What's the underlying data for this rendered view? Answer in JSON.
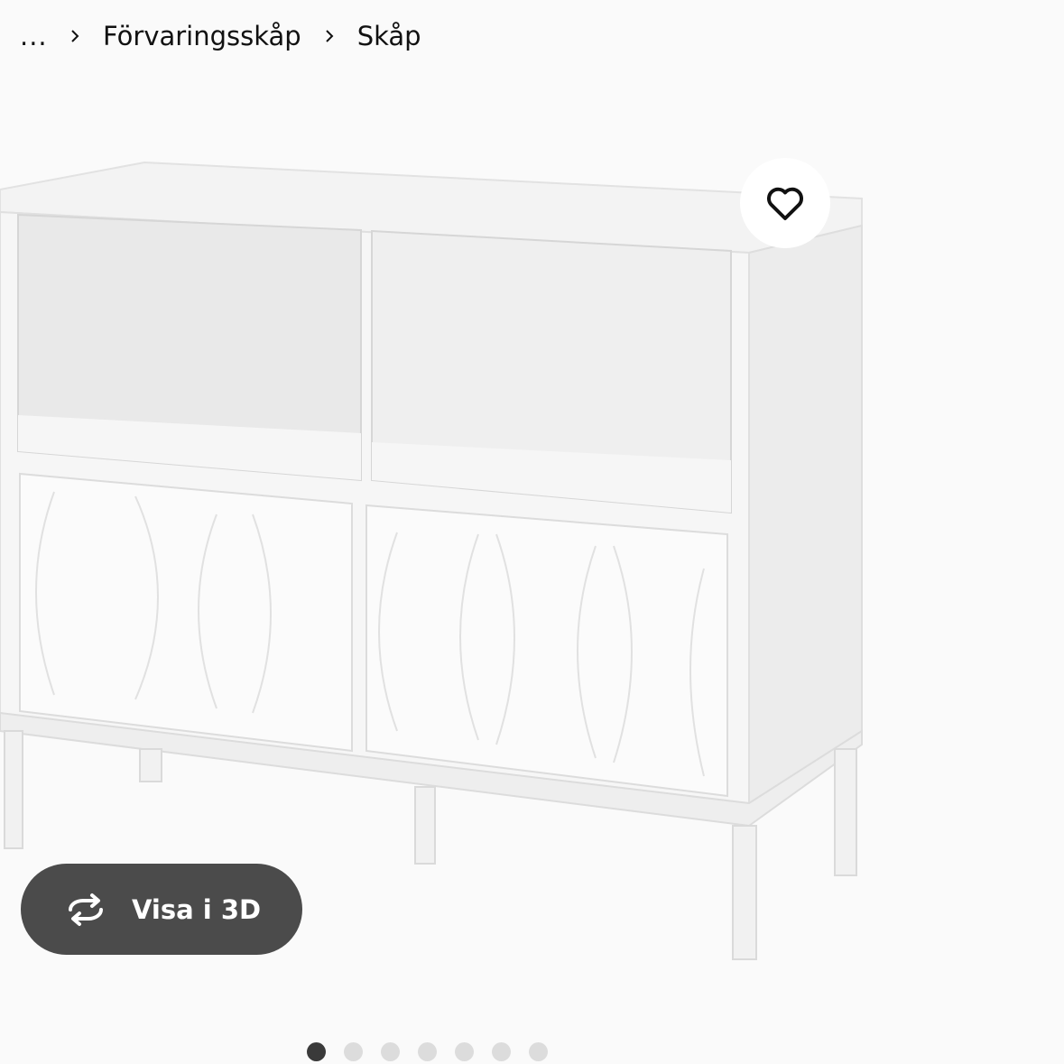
{
  "breadcrumb": {
    "ellipsis": "...",
    "items": [
      "Förvaringsskåp",
      "Skåp"
    ]
  },
  "view_3d": {
    "label": "Visa i 3D",
    "icon": "rotate-3d-icon"
  },
  "favourite": {
    "icon": "heart-icon"
  },
  "carousel": {
    "total": 7,
    "active_index": 0
  },
  "colors": {
    "pill": "#4b4b4b",
    "dot_active": "#3a3a3a",
    "dot_inactive": "#dcdcdc"
  }
}
